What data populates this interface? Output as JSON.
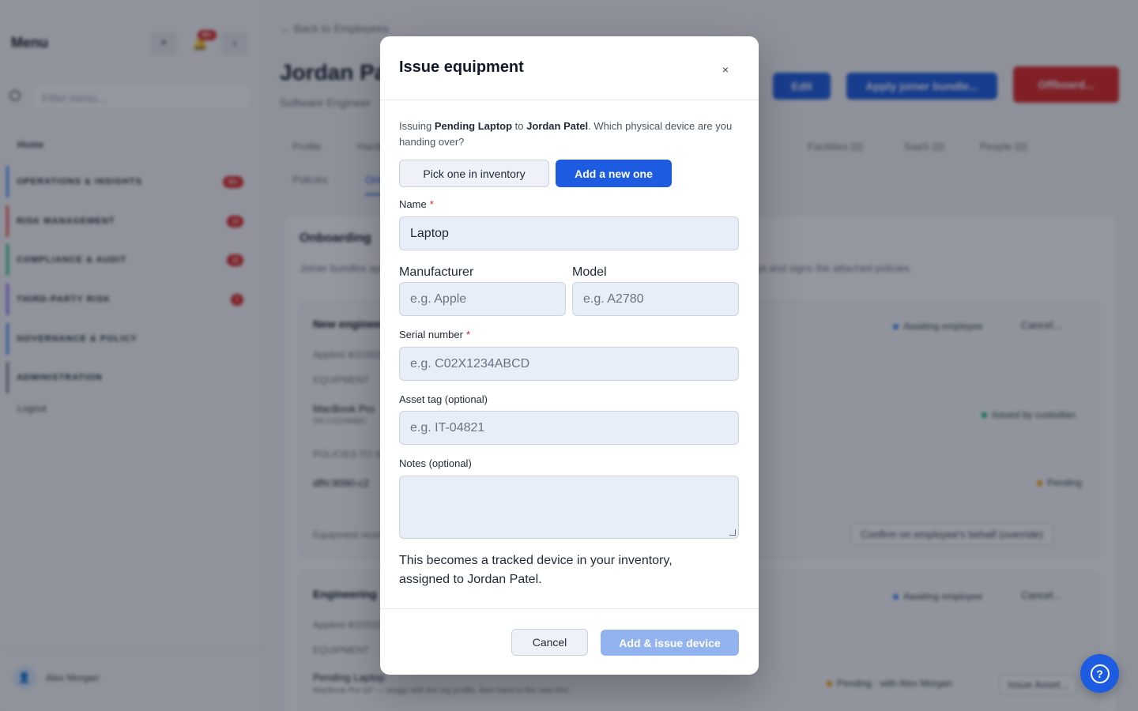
{
  "sidebar": {
    "title": "Menu",
    "add_icon": "plus-icon",
    "notif_badge": "99+",
    "collapse_icon": "chevron-left-icon",
    "filter_placeholder": "Filter menu...",
    "home": "Home",
    "sections": [
      {
        "label": "OPERATIONS & INSIGHTS",
        "count": "99+",
        "color": "#3b82f6"
      },
      {
        "label": "RISK MANAGEMENT",
        "count": "13",
        "color": "#ef4444"
      },
      {
        "label": "COMPLIANCE & AUDIT",
        "count": "12",
        "color": "#10b981"
      },
      {
        "label": "THIRD-PARTY RISK",
        "count": "7",
        "color": "#8b5cf6"
      },
      {
        "label": "GOVERNANCE & POLICY",
        "count": "",
        "color": "#3b82f6"
      },
      {
        "label": "ADMINISTRATION",
        "count": "",
        "color": "#6b7280"
      }
    ],
    "logout": "Logout",
    "user_name": "Alex Morgan"
  },
  "page": {
    "back": "← Back to Employees",
    "employee_name": "Jordan Patel",
    "employee_role": "Software Engineer",
    "edit": "Edit",
    "apply_bundle": "Apply joiner bundle...",
    "offboard": "Offboard...",
    "tabs_row1": [
      "Profile",
      "Hardware",
      "Facilities (0)",
      "SaaS (0)",
      "People (0)"
    ],
    "tabs_row2": [
      "Policies",
      "Onboarding"
    ],
    "onboarding_title": "Onboarding",
    "onboarding_desc": "Joiner bundles applied to this employee. Once every item is provisioned the employee confirms receipt and signs the attached policies.",
    "bundle1": {
      "title": "New engineer",
      "status": "Awaiting employee",
      "cancel": "Cancel...",
      "applied": "Applied 4/2/2025",
      "equipment_heading": "EQUIPMENT",
      "device": "MacBook Pro",
      "device_serial": "SN C02X9ABC",
      "device_status": "Issued by custodian",
      "policies_heading": "POLICIES TO SIGN",
      "policy": "dfN:9090-c2",
      "policy_status": "Pending",
      "equipment_note": "Equipment received?",
      "confirm": "Confirm on employee's behalf (override)"
    },
    "bundle2": {
      "title": "Engineering",
      "status": "Awaiting employee",
      "cancel": "Cancel...",
      "applied": "Applied 4/2/2025",
      "equipment_heading": "EQUIPMENT",
      "device": "Pending Laptop",
      "device_desc": "MacBook Pro 16\" — image with the org profile, then hand to the new hire.",
      "device_status": "Pending · with Alex Morgan",
      "issue": "Issue Asset..."
    }
  },
  "modal": {
    "title": "Issue equipment",
    "close_icon": "close-icon",
    "intro_prefix": "Issuing ",
    "intro_item": "Pending Laptop",
    "intro_mid": " to ",
    "intro_person": "Jordan Patel",
    "intro_suffix": ". Which physical device are you handing over?",
    "option_inventory": "Pick one in inventory",
    "option_new": "Add a new one",
    "selected_option": "Add a new one",
    "name_label": "Name",
    "name_value": "Laptop",
    "manufacturer_label": "Manufacturer",
    "manufacturer_placeholder": "e.g. Apple",
    "model_label": "Model",
    "model_placeholder": "e.g. A2780",
    "serial_label": "Serial number",
    "serial_placeholder": "e.g. C02X1234ABCD",
    "asset_label": "Asset tag (optional)",
    "asset_placeholder": "e.g. IT-04821",
    "notes_label": "Notes (optional)",
    "notes_value": "",
    "required_mark": "*",
    "note": "This becomes a tracked device in your inventory, assigned to Jordan Patel.",
    "cancel": "Cancel",
    "submit": "Add & issue device"
  },
  "help": {
    "icon": "help-circle-icon",
    "glyph": "?"
  },
  "colors": {
    "primary": "#1d5be0",
    "primary_disabled": "#93b2f0",
    "danger": "#dc2626"
  }
}
